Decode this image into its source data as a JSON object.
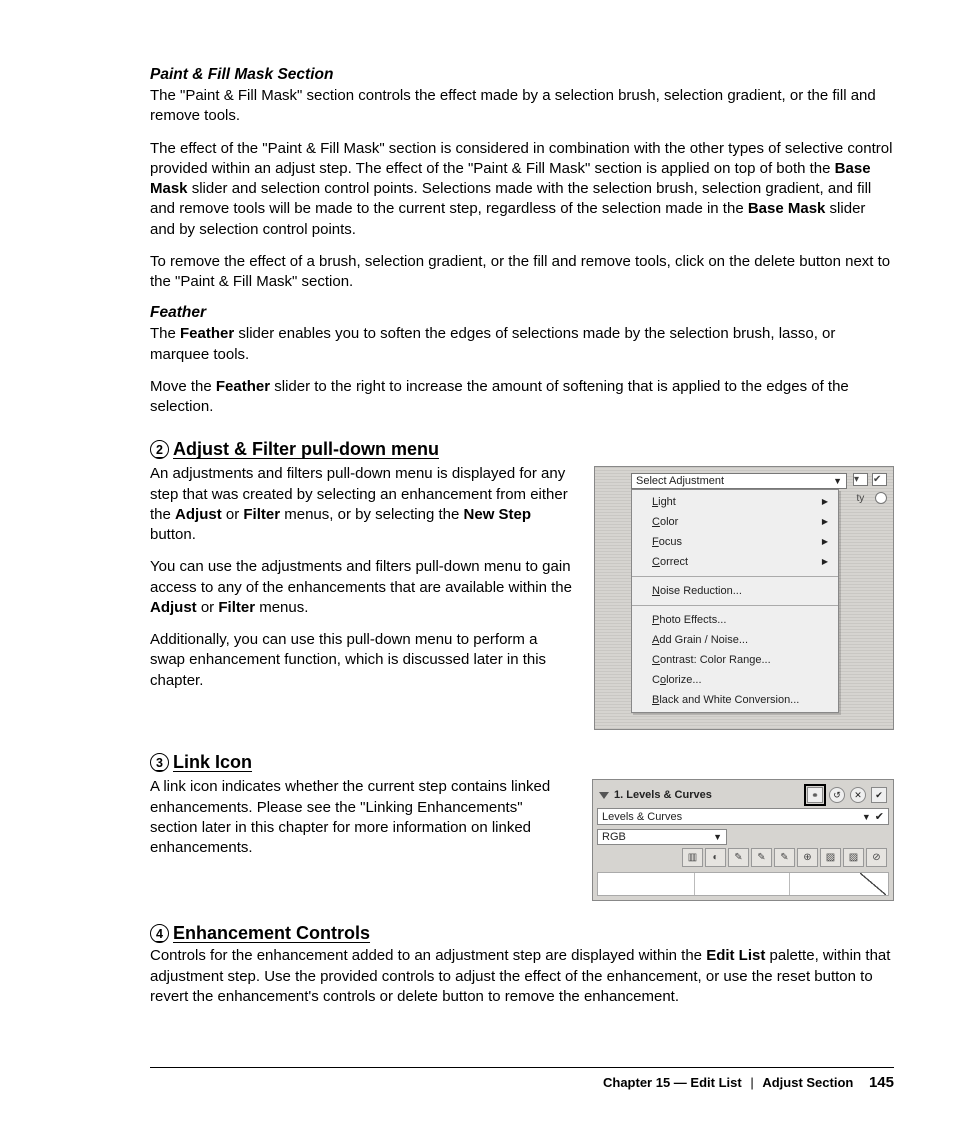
{
  "section1": {
    "heading": "Paint & Fill Mask Section",
    "p1": "The \"Paint & Fill Mask\" section controls the effect made by a selection brush, selection gradient, or the fill and remove tools.",
    "p2a": "The effect of the \"Paint & Fill Mask\" section is considered in combination with the other types of selective control provided within an adjust step. The effect of the \"Paint & Fill Mask\" section is applied on top of both the ",
    "p2b": "Base Mask",
    "p2c": " slider and selection control points. Selections made with the selection brush, selection gradient, and fill and remove tools will be made to the current step, regardless of the selection made in the ",
    "p2d": "Base Mask",
    "p2e": " slider and by selection control points.",
    "p3": "To remove the effect of a brush, selection gradient, or the fill and remove tools, click on the delete button next to the \"Paint & Fill Mask\" section."
  },
  "section2": {
    "heading": "Feather",
    "p1a": "The ",
    "p1b": "Feather",
    "p1c": " slider enables you to soften the edges of selections made by the selection brush, lasso, or marquee tools.",
    "p2a": "Move the ",
    "p2b": "Feather",
    "p2c": " slider to the right to increase the amount of softening that is applied to the edges of the selection."
  },
  "section3": {
    "num": "2",
    "heading": "Adjust & Filter pull-down menu",
    "p1a": "An adjustments and filters pull-down menu is displayed for any step that was created by selecting an enhancement from either the ",
    "p1b": "Adjust",
    "p1c": " or ",
    "p1d": "Filter",
    "p1e": " menus, or by selecting the ",
    "p1f": "New Step",
    "p1g": " button.",
    "p2a": "You can use the adjustments and filters pull-down menu to gain access to any of the enhancements that are available within the ",
    "p2b": "Adjust",
    "p2c": " or ",
    "p2d": "Filter",
    "p2e": " menus.",
    "p3": "Additionally, you can use this pull-down menu to perform a swap enhancement function, which is discussed later in this chapter."
  },
  "menu": {
    "head": "Select Adjustment",
    "sidelabel": "ty",
    "items_sub": [
      "Light",
      "Color",
      "Focus",
      "Correct"
    ],
    "items_sub_u": [
      "L",
      "C",
      "F",
      "C"
    ],
    "items_mid": [
      "Noise Reduction..."
    ],
    "items_mid_u": [
      "N"
    ],
    "items_bot": [
      "Photo Effects...",
      "Add Grain / Noise...",
      "Contrast: Color Range...",
      "Colorize...",
      "Black and White Conversion..."
    ],
    "items_bot_u": [
      "P",
      "A",
      "C",
      "C",
      "B"
    ]
  },
  "section4": {
    "num": "3",
    "heading": "Link Icon",
    "p1": "A link icon indicates whether the current step contains linked enhancements. Please see the \"Linking Enhancements\" section later in this chapter for more information on linked enhancements."
  },
  "panel": {
    "title": "1. Levels & Curves",
    "field1": "Levels & Curves",
    "field2": "RGB"
  },
  "section5": {
    "num": "4",
    "heading": "Enhancement Controls",
    "p1a": "Controls for the enhancement added to an adjustment step are displayed within the ",
    "p1b": "Edit List",
    "p1c": " palette, within that adjustment step. Use the provided controls to adjust the effect of the enhancement, or use the reset button to revert the enhancement's controls or delete button to remove the enhancement."
  },
  "footer": {
    "chapter": "Chapter 15 — Edit List",
    "section": "Adjust Section",
    "page": "145"
  }
}
